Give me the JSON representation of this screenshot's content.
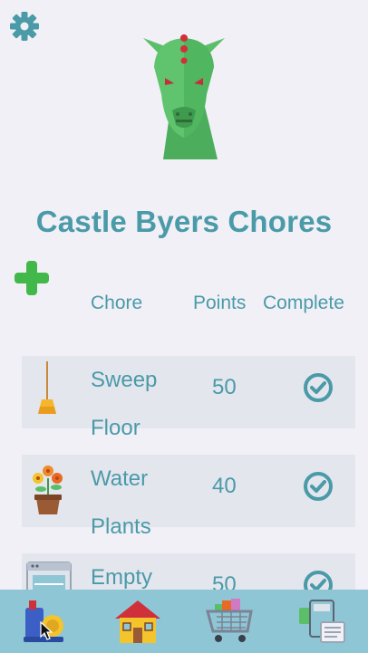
{
  "header": {
    "title": "Castle Byers Chores",
    "settings_icon": "gear-icon",
    "mascot_icon": "demogorgon-mascot-icon",
    "add_icon": "plus-icon"
  },
  "table": {
    "columns": [
      "Chore",
      "Points",
      "Complete"
    ],
    "rows": [
      {
        "name_line1": "Sweep",
        "name_line2": "Floor",
        "points": "50",
        "icon": "broom-icon",
        "complete_icon": "check-circle-icon"
      },
      {
        "name_line1": "Water",
        "name_line2": "Plants",
        "points": "40",
        "icon": "flower-pot-icon",
        "complete_icon": "check-circle-icon"
      },
      {
        "name_line1": "Empty",
        "name_line2": "",
        "points": "50",
        "icon": "dishwasher-icon",
        "complete_icon": "check-circle-icon"
      }
    ]
  },
  "tabbar": {
    "tabs": [
      {
        "name": "chores",
        "icon": "vacuum-cleaner-icon"
      },
      {
        "name": "home",
        "icon": "house-icon"
      },
      {
        "name": "shop",
        "icon": "shopping-cart-icon"
      },
      {
        "name": "bank",
        "icon": "calculator-money-icon"
      }
    ]
  },
  "colors": {
    "background": "#f1f0f7",
    "accent_text": "#4a9aa8",
    "add_green": "#43b84a",
    "tabbar": "#8fc6d6",
    "row_bg": "#e4e6ee"
  }
}
